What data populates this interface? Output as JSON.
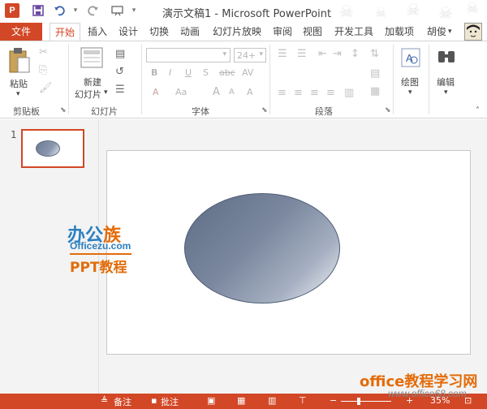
{
  "window": {
    "title": "演示文稿1 - Microsoft PowerPoint"
  },
  "quick_access": {
    "app_icon": "P",
    "icons": [
      "powerpoint-icon",
      "save-icon",
      "undo-icon",
      "redo-icon",
      "start-from-beginning-icon"
    ]
  },
  "tabs": {
    "file": "文件",
    "home": "开始",
    "insert": "插入",
    "design": "设计",
    "transitions": "切换",
    "animations": "动画",
    "slideshow": "幻灯片放映",
    "review": "审阅",
    "view": "视图",
    "developer": "开发工具",
    "addins": "加载项",
    "user": "胡俊"
  },
  "ribbon": {
    "clipboard": {
      "label": "剪贴板",
      "paste": "粘贴"
    },
    "slides": {
      "label": "幻灯片",
      "new_slide_line1": "新建",
      "new_slide_line2": "幻灯片"
    },
    "font": {
      "label": "字体",
      "font_name": "",
      "font_size": "24+",
      "bold": "B",
      "italic": "I",
      "underline": "U",
      "shadow": "S",
      "strike": "abc",
      "spacing": "AV",
      "case": "Aa",
      "grow": "A",
      "shrink": "A",
      "clear": "A"
    },
    "paragraph": {
      "label": "段落"
    },
    "drawing": {
      "label": "绘图"
    },
    "editing": {
      "label": "编辑"
    }
  },
  "thumbnail_pane": {
    "slide_number": "1"
  },
  "watermark": {
    "logo_blue": "办公",
    "logo_orange": "族",
    "url": "Officezu.com",
    "ppt": "PPT教程",
    "corner_text": "office教程学习网",
    "corner_url": "www.office68.com"
  },
  "statusbar": {
    "notes": "备注",
    "comments": "批注",
    "zoom": "35%"
  },
  "colors": {
    "accent": "#d24726",
    "watermark_blue": "#2a7fc0",
    "watermark_orange": "#e36c09"
  }
}
